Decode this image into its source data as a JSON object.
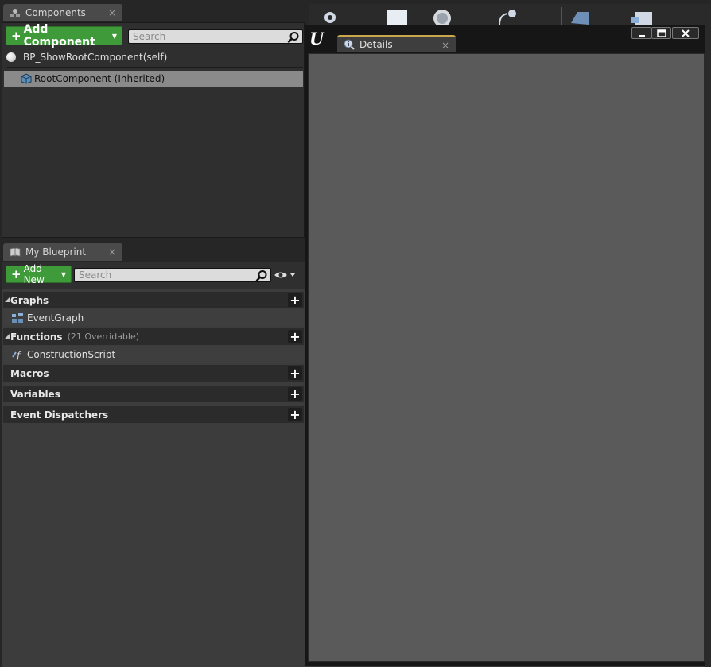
{
  "components": {
    "tab_label": "Components",
    "add_button": "Add Component",
    "search_placeholder": "Search",
    "self_item": "BP_ShowRootComponent(self)",
    "root_item": "RootComponent (Inherited)"
  },
  "my_blueprint": {
    "tab_label": "My Blueprint",
    "add_button": "Add New",
    "search_placeholder": "Search",
    "categories": [
      {
        "label": "Graphs",
        "count": "",
        "items": [
          "EventGraph"
        ]
      },
      {
        "label": "Functions",
        "count": "(21 Overridable)",
        "items": [
          "ConstructionScript"
        ]
      },
      {
        "label": "Macros",
        "count": "",
        "items": []
      },
      {
        "label": "Variables",
        "count": "",
        "items": []
      },
      {
        "label": "Event Dispatchers",
        "count": "",
        "items": []
      }
    ]
  },
  "details": {
    "tab_label": "Details"
  },
  "icons": {
    "close": "×",
    "plus": "+",
    "minimize": "minimize-icon",
    "maximize": "maximize-icon",
    "window_close": "close-icon"
  },
  "colors": {
    "accent_green": "#3f9b3a",
    "tab_highlight": "#c8a84a"
  }
}
